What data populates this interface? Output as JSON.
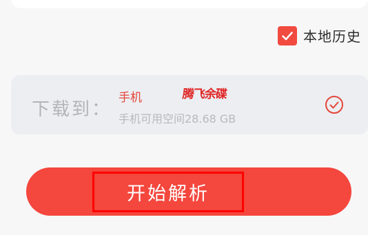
{
  "history": {
    "label": "本地历史",
    "checked": true,
    "icon": "checkmark-icon"
  },
  "storage": {
    "label": "下载到：",
    "device": "手机",
    "watermark": "腾飞余碟",
    "free_space": "手机可用空间28.68 GB",
    "selected_icon": "check-circle-icon"
  },
  "action": {
    "start_label": "开始解析"
  },
  "colors": {
    "accent": "#f4473d",
    "highlight": "#ff0000",
    "card": "#eceef2",
    "background": "#f7f7f8"
  }
}
